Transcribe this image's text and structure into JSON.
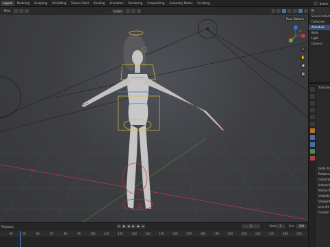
{
  "topbar": {
    "tabs": [
      "Layout",
      "Modeling",
      "Sculpting",
      "UV Editing",
      "Texture Paint",
      "Shading",
      "Animation",
      "Rendering",
      "Compositing",
      "Geometry Nodes",
      "Scripting"
    ],
    "active_tab": "Layout",
    "scene_label": "Scene"
  },
  "viewport": {
    "mode": "Pose",
    "transform_orientation": "Global",
    "pose_options": "Pose Options",
    "gizmo_axes": [
      "X",
      "Y",
      "Z"
    ],
    "colors": {
      "axis_x": "#c53b45",
      "axis_y": "#79a33a",
      "axis_z": "#3f72c9",
      "rig_yellow": "#d9c23a",
      "rig_red": "#c6303c"
    }
  },
  "outliner": {
    "rows": [
      "Scene Collection",
      "Collection",
      "Armature",
      "Body",
      "Light",
      "Camera"
    ]
  },
  "properties": {
    "sections": [
      "Transform",
      "Delta Transform",
      "Relations",
      "Collections",
      "Instancing",
      "Motion Paths",
      "Visibility",
      "Viewport Display",
      "Line Art",
      "Custom Properties"
    ]
  },
  "timeline": {
    "label": "Playback",
    "current_frame": "1",
    "start_label": "Start",
    "start": "1",
    "end_label": "End",
    "end": "250",
    "ruler_ticks": [
      "40",
      "50",
      "60",
      "70",
      "80",
      "90",
      "100",
      "110",
      "120",
      "130",
      "140",
      "150",
      "160",
      "170",
      "180",
      "190",
      "200",
      "210",
      "220",
      "230",
      "240",
      "250"
    ]
  }
}
